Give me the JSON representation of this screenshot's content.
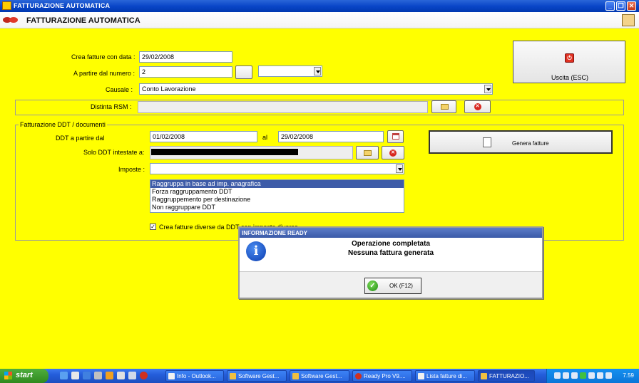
{
  "window": {
    "title": "FATTURAZIONE AUTOMATICA",
    "controls": [
      "_",
      "❐",
      "✕"
    ]
  },
  "header": {
    "title": "FATTURAZIONE AUTOMATICA"
  },
  "form": {
    "crea_label": "Crea fatture con data :",
    "crea_value": "29/02/2008",
    "numero_label": "A partire dal numero :",
    "numero_value": "2",
    "causale_label": "Causale :",
    "causale_value": "Conto Lavorazione",
    "distinta_label": "Distinta RSM :"
  },
  "uscita": {
    "label": "Uscita (ESC)"
  },
  "ddt": {
    "legend": "Fatturazione DDT / documenti",
    "da_label": "DDT a partire dal",
    "da_value": "01/02/2008",
    "al_label": "al",
    "al_value": "29/02/2008",
    "intestate_label": "Solo DDT intestate a:",
    "imposte_label": "Imposte :",
    "grouping_options": [
      "Raggruppa in base ad imp. anagrafica",
      "Forza raggruppamento DDT",
      "Raggruppemento per destinazione",
      "Non raggruppare DDT"
    ],
    "checkbox_label": "Crea fatture diverse da DDT con imposte diverse",
    "checkbox_mark": "✓"
  },
  "genera": {
    "label": "Genera fatture"
  },
  "dialog": {
    "title": "INFORMAZIONE READY",
    "icon": "i",
    "line1": "Operazione completata",
    "line2": "Nessuna fattura generata",
    "ok_label": "OK (F12)",
    "ok_icon": "✓"
  },
  "taskbar": {
    "start_label": "start",
    "tasks": [
      "Info - Outlook...",
      "Software Gest...",
      "Software Gest...",
      "Ready Pro V9....",
      "Lista fatture di...",
      "FATTURAZIO..."
    ],
    "clock": "7.59"
  },
  "colors": {
    "background": "#ffff00",
    "title_blue": "#0a46c8",
    "selection": "#3e5ca8",
    "task_green": "#2f8a1e"
  }
}
